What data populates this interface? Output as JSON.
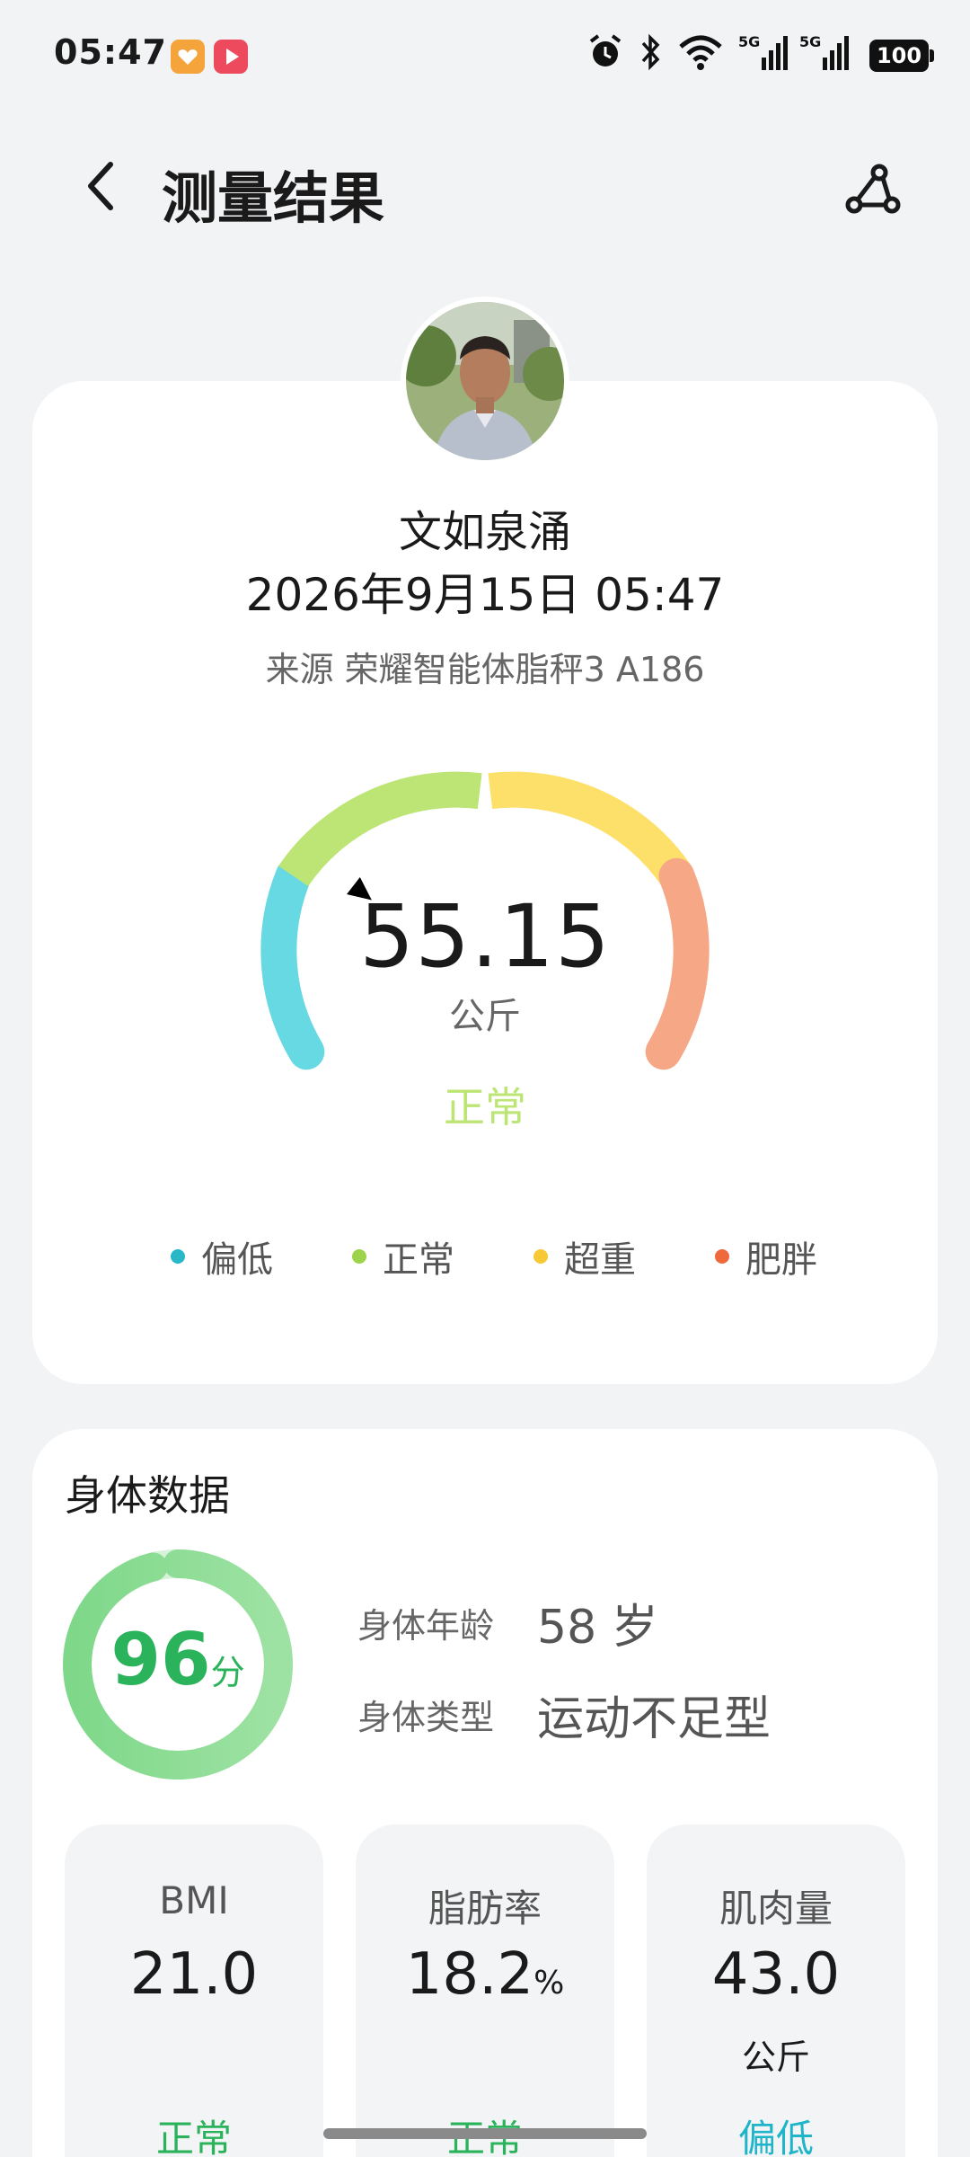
{
  "status_bar": {
    "time": "05:47",
    "battery": "100",
    "icons": [
      "alarm-icon",
      "bluetooth-icon",
      "wifi-icon",
      "signal-5g-icon",
      "signal-5g-icon"
    ]
  },
  "header": {
    "title": "测量结果",
    "back_icon": "back-arrow-icon",
    "share_icon": "share-icon"
  },
  "profile": {
    "name": "文如泉涌",
    "datetime": "2026年9月15日 05:47",
    "source": "来源 荣耀智能体脂秤3 A186"
  },
  "weight": {
    "value": "55.15",
    "unit": "公斤",
    "status": "正常",
    "gauge_level_percent": 30
  },
  "legend": [
    {
      "label": "偏低",
      "color": "#29b8c8"
    },
    {
      "label": "正常",
      "color": "#9cd34a"
    },
    {
      "label": "超重",
      "color": "#f7c936"
    },
    {
      "label": "肥胖",
      "color": "#ee6a3d"
    }
  ],
  "gauge_colors": {
    "low": "#66d9e2",
    "normal": "#bce576",
    "overweight": "#fde06a",
    "obese": "#f6a785"
  },
  "body_data": {
    "title": "身体数据",
    "score": "96",
    "score_unit": "分",
    "score_percent": 96,
    "age_label": "身体年龄",
    "age_value": "58 岁",
    "type_label": "身体类型",
    "type_value": "运动不足型"
  },
  "metrics": [
    {
      "label": "BMI",
      "value": "21.0",
      "suffix": "",
      "unit": "",
      "status": "正常",
      "status_color": "#2bb35b"
    },
    {
      "label": "脂肪率",
      "value": "18.2",
      "suffix": "%",
      "unit": "",
      "status": "正常",
      "status_color": "#2bb35b"
    },
    {
      "label": "肌肉量",
      "value": "43.0",
      "suffix": "",
      "unit": "公斤",
      "status": "偏低",
      "status_color": "#1fb5c9"
    }
  ]
}
